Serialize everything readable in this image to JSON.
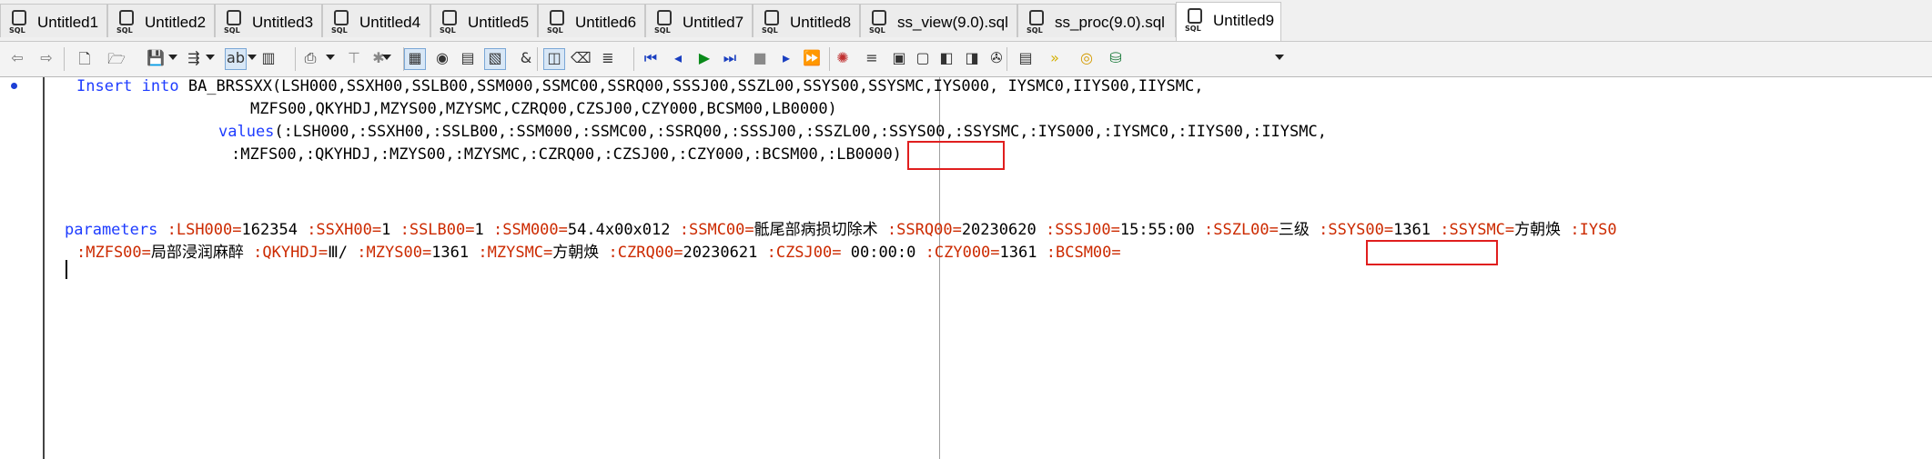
{
  "tabs": [
    {
      "label": "Untitled1",
      "icon": "sql-file-icon",
      "active": false
    },
    {
      "label": "Untitled2",
      "icon": "sql-file-icon",
      "active": false
    },
    {
      "label": "Untitled3",
      "icon": "sql-file-icon",
      "active": false
    },
    {
      "label": "Untitled4",
      "icon": "sql-file-icon",
      "active": false
    },
    {
      "label": "Untitled5",
      "icon": "sql-file-icon",
      "active": false
    },
    {
      "label": "Untitled6",
      "icon": "sql-file-icon",
      "active": false
    },
    {
      "label": "Untitled7",
      "icon": "sql-file-icon",
      "active": false
    },
    {
      "label": "Untitled8",
      "icon": "sql-file-icon",
      "active": false
    },
    {
      "label": "ss_view(9.0).sql",
      "icon": "sql-file-icon",
      "active": false
    },
    {
      "label": "ss_proc(9.0).sql",
      "icon": "sql-file-icon",
      "active": false
    },
    {
      "label": "Untitled9",
      "icon": "sql-file-icon",
      "active": true
    }
  ],
  "sql_icon_text": "SQL",
  "toolbar": {
    "icons": [
      "back-arrow-icon",
      "forward-arrow-icon",
      "new-document-icon",
      "open-file-icon",
      "save-icon",
      "save-as-icon",
      "text-mode-icon",
      "columns-icon",
      "print-icon",
      "filter-icon",
      "clear-filter-icon",
      "query-builder-icon",
      "explain-plan-icon",
      "execute-icon",
      "describe-icon",
      "ampersand-icon",
      "comment-icon",
      "uncomment-icon",
      "indent-icon",
      "first-record-icon",
      "prev-record-icon",
      "run-icon",
      "run-to-cursor-icon",
      "stop-icon",
      "step-into-icon",
      "step-over-icon",
      "compile-icon",
      "debug-icon",
      "bookmark-icon",
      "toggle-bookmark-icon",
      "prev-bookmark-icon",
      "next-bookmark-icon",
      "plugin-icon",
      "code-assistant-icon",
      "fast-forward-icon",
      "light-bulb-icon",
      "database-icon"
    ]
  },
  "editor": {
    "sql": {
      "line1_kw": "Insert into",
      "line1_rest": " BA_BRSSXX(LSH000,SSXH00,SSLB00,SSM000,SSMC00,SSRQ00,SSSJ00,SSZL00,SSYS00,SSYSMC,IYS000, IYSMC0,IIYS00,IIYSMC,",
      "line2": "MZFS00,QKYHDJ,MZYS00,MZYSMC,CZRQ00,CZSJ00,CZY000,BCSM00,LB0000)",
      "line3_kw": "values",
      "line3_rest": "(:LSH000,:SSXH00,:SSLB00,:SSM000,:SSMC00,:SSRQ00,:SSSJ00,:SSZL00,:SSYS00,:SSYSMC,:IYS000,:IYSMC0,:IIYS00,:IIYSMC,",
      "line4": ":MZFS00,:QKYHDJ,:MZYS00,:MZYSMC,:CZRQ00,:CZSJ00,:CZY000,:BCSM00,:LB0000)"
    },
    "parameters_label": "parameters",
    "params_line1": [
      {
        "name": ":LSH000",
        "value": "162354"
      },
      {
        "name": ":SSXH00",
        "value": "1"
      },
      {
        "name": ":SSLB00",
        "value": "1"
      },
      {
        "name": ":SSM000",
        "value": "54.4x00x012"
      },
      {
        "name": ":SSMC00",
        "value": "骶尾部病损切除术"
      },
      {
        "name": ":SSRQ00",
        "value": "20230620"
      },
      {
        "name": ":SSSJ00",
        "value": "15:55:00"
      },
      {
        "name": ":SSZL00",
        "value": "三级"
      },
      {
        "name": ":SSYS00",
        "value": "1361"
      },
      {
        "name": ":SSYSMC",
        "value": "方朝焕"
      },
      {
        "name": ":IYS0",
        "value": ""
      }
    ],
    "params_line2": [
      {
        "name": ":MZFS00",
        "value": "局部浸润麻醉"
      },
      {
        "name": ":QKYHDJ",
        "value": "Ⅲ/"
      },
      {
        "name": ":MZYS00",
        "value": "1361"
      },
      {
        "name": ":MZYSMC",
        "value": "方朝焕"
      },
      {
        "name": ":CZRQ00",
        "value": "20230621"
      },
      {
        "name": ":CZSJ00",
        "value": " 00:00:0"
      },
      {
        "name": ":CZY000",
        "value": "1361"
      },
      {
        "name": ":BCSM00",
        "value": ""
      }
    ]
  },
  "colors": {
    "keyword": "#1e3cff",
    "param_name": "#cc2a00",
    "highlight_box": "#e01e1e"
  }
}
